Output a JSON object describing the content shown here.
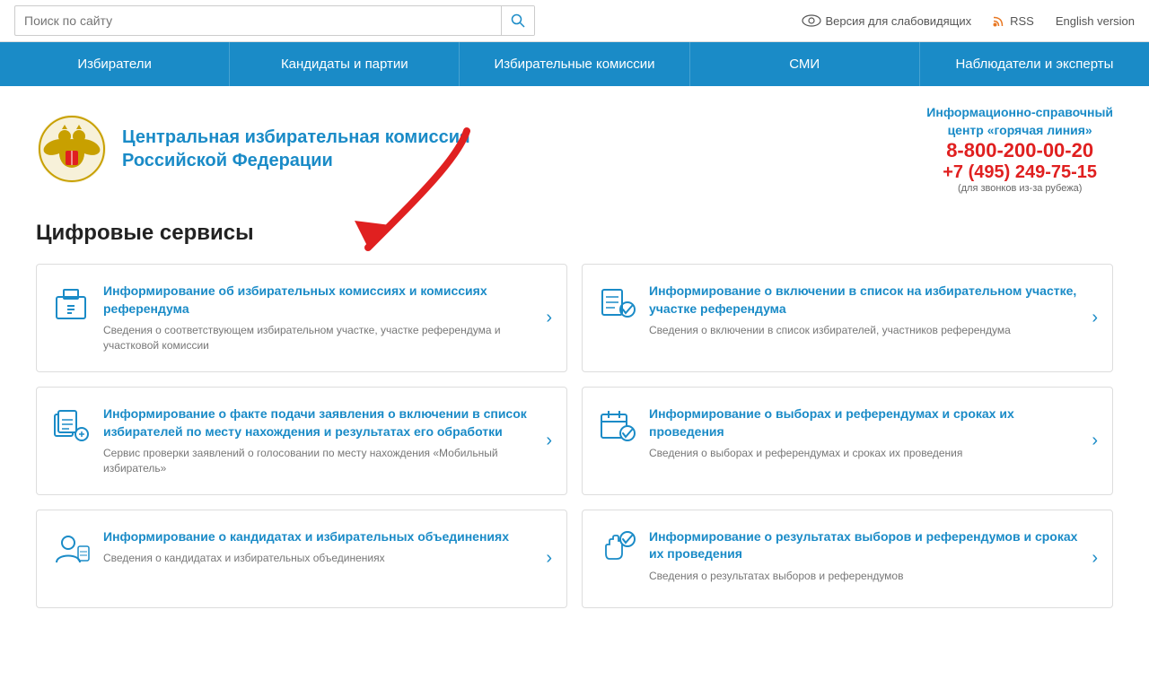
{
  "topbar": {
    "search_placeholder": "Поиск по сайту",
    "vision_label": "Версия для слабовидящих",
    "rss_label": "RSS",
    "english_label": "English version"
  },
  "nav": {
    "items": [
      "Избиратели",
      "Кандидаты и партии",
      "Избирательные комиссии",
      "СМИ",
      "Наблюдатели и эксперты"
    ]
  },
  "header": {
    "org_name_line1": "Центральная избирательная комиссия",
    "org_name_line2": "Российской Федерации",
    "hotline_label_line1": "Информационно-справочный",
    "hotline_label_line2": "центр «горячая линия»",
    "phone1": "8-800-200-00-20",
    "phone2": "+7 (495) 249-75-15",
    "phone_note": "(для звонков из-за рубежа)"
  },
  "section_title": "Цифровые сервисы",
  "cards": [
    {
      "id": "card1",
      "title": "Информирование об избирательных комиссиях и комиссиях референдума",
      "desc": "Сведения о соответствующем избирательном участке, участке референдума и участковой комиссии",
      "icon": "ballot-box"
    },
    {
      "id": "card2",
      "title": "Информирование о включении в список на избирательном участке, участке референдума",
      "desc": "Сведения о включении в список избирателей, участников референдума",
      "icon": "list-check"
    },
    {
      "id": "card3",
      "title": "Информирование о факте подачи заявления о включении в список избирателей по месту нахождения и результатах его обработки",
      "desc": "Сервис проверки заявлений о голосовании по месту нахождения «Мобильный избиратель»",
      "icon": "doc-list"
    },
    {
      "id": "card4",
      "title": "Информирование о выборах и референдумах и сроках их проведения",
      "desc": "Сведения о выборах и референдумах и сроках их проведения",
      "icon": "calendar-check"
    },
    {
      "id": "card5",
      "title": "Информирование о кандидатах и избирательных объединениях",
      "desc": "Сведения о кандидатах и избирательных объединениях",
      "icon": "person-card"
    },
    {
      "id": "card6",
      "title": "Информирование о результатах выборов и референдумов и сроках их проведения",
      "desc": "Сведения о результатах выборов и референдумов",
      "icon": "hand-vote"
    }
  ]
}
